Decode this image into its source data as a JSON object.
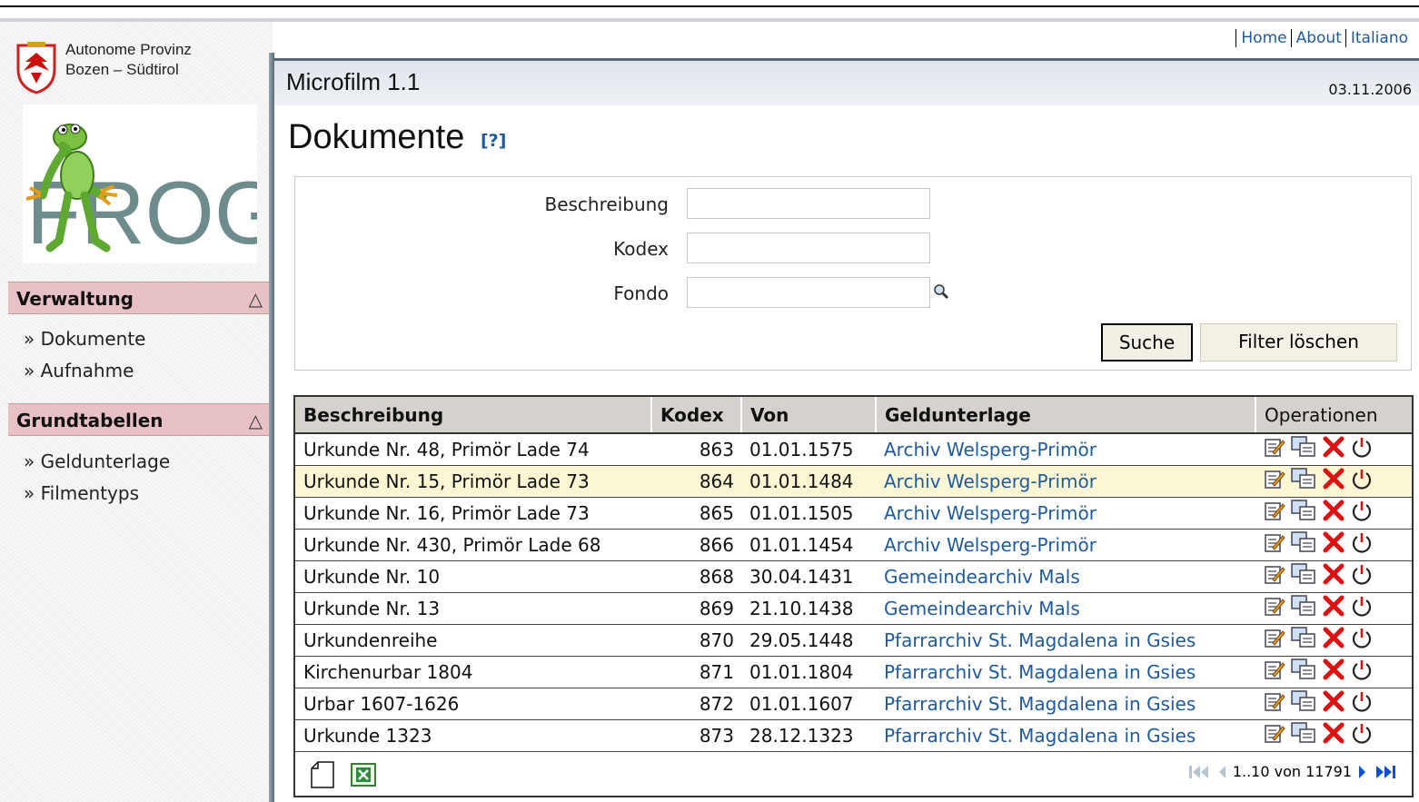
{
  "header": {
    "links": [
      "Home",
      "About",
      "Italiano"
    ],
    "province_line1": "Autonome Provinz",
    "province_line2": "Bozen – Südtirol",
    "logo_text": "FROG",
    "app_title": "Microfilm 1.1",
    "date": "03.11.2006"
  },
  "sidebar": {
    "sections": [
      {
        "title": "Verwaltung",
        "items": [
          "» Dokumente",
          "» Aufnahme"
        ]
      },
      {
        "title": "Grundtabellen",
        "items": [
          "» Geldunterlage",
          "» Filmentyps"
        ]
      }
    ],
    "collapse_glyph": "△"
  },
  "page": {
    "title": "Dokumente",
    "help": "[?]"
  },
  "filter": {
    "labels": [
      "Beschreibung",
      "Kodex",
      "Fondo"
    ],
    "values": [
      "",
      "",
      ""
    ],
    "search_button": "Suche",
    "clear_button": "Filter löschen"
  },
  "table": {
    "columns": [
      "Beschreibung",
      "Kodex",
      "Von",
      "Geldunterlage",
      "Operationen"
    ],
    "rows": [
      [
        "Urkunde Nr. 48, Primör Lade 74",
        "863",
        "01.01.1575",
        "Archiv Welsperg-Primör"
      ],
      [
        "Urkunde Nr. 15, Primör Lade 73",
        "864",
        "01.01.1484",
        "Archiv Welsperg-Primör"
      ],
      [
        "Urkunde Nr. 16, Primör Lade 73",
        "865",
        "01.01.1505",
        "Archiv Welsperg-Primör"
      ],
      [
        "Urkunde Nr. 430, Primör Lade 68",
        "866",
        "01.01.1454",
        "Archiv Welsperg-Primör"
      ],
      [
        "Urkunde Nr. 10",
        "868",
        "30.04.1431",
        "Gemeindearchiv Mals"
      ],
      [
        "Urkunde Nr. 13",
        "869",
        "21.10.1438",
        "Gemeindearchiv Mals"
      ],
      [
        "Urkundenreihe",
        "870",
        "29.05.1448",
        "Pfarrarchiv St. Magdalena in Gsies"
      ],
      [
        "Kirchenurbar 1804",
        "871",
        "01.01.1804",
        "Pfarrarchiv St. Magdalena in Gsies"
      ],
      [
        "Urbar 1607-1626",
        "872",
        "01.01.1607",
        "Pfarrarchiv St. Magdalena in Gsies"
      ],
      [
        "Urkunde 1323",
        "873",
        "28.12.1323",
        "Pfarrarchiv St. Magdalena in Gsies"
      ]
    ],
    "highlight_row": 1,
    "pager_text": "1..10 von 11791"
  },
  "colors": {
    "menu_header": "#e8c1c6",
    "link": "#1f5a9e",
    "row_highlight": "#fbf7d5"
  }
}
